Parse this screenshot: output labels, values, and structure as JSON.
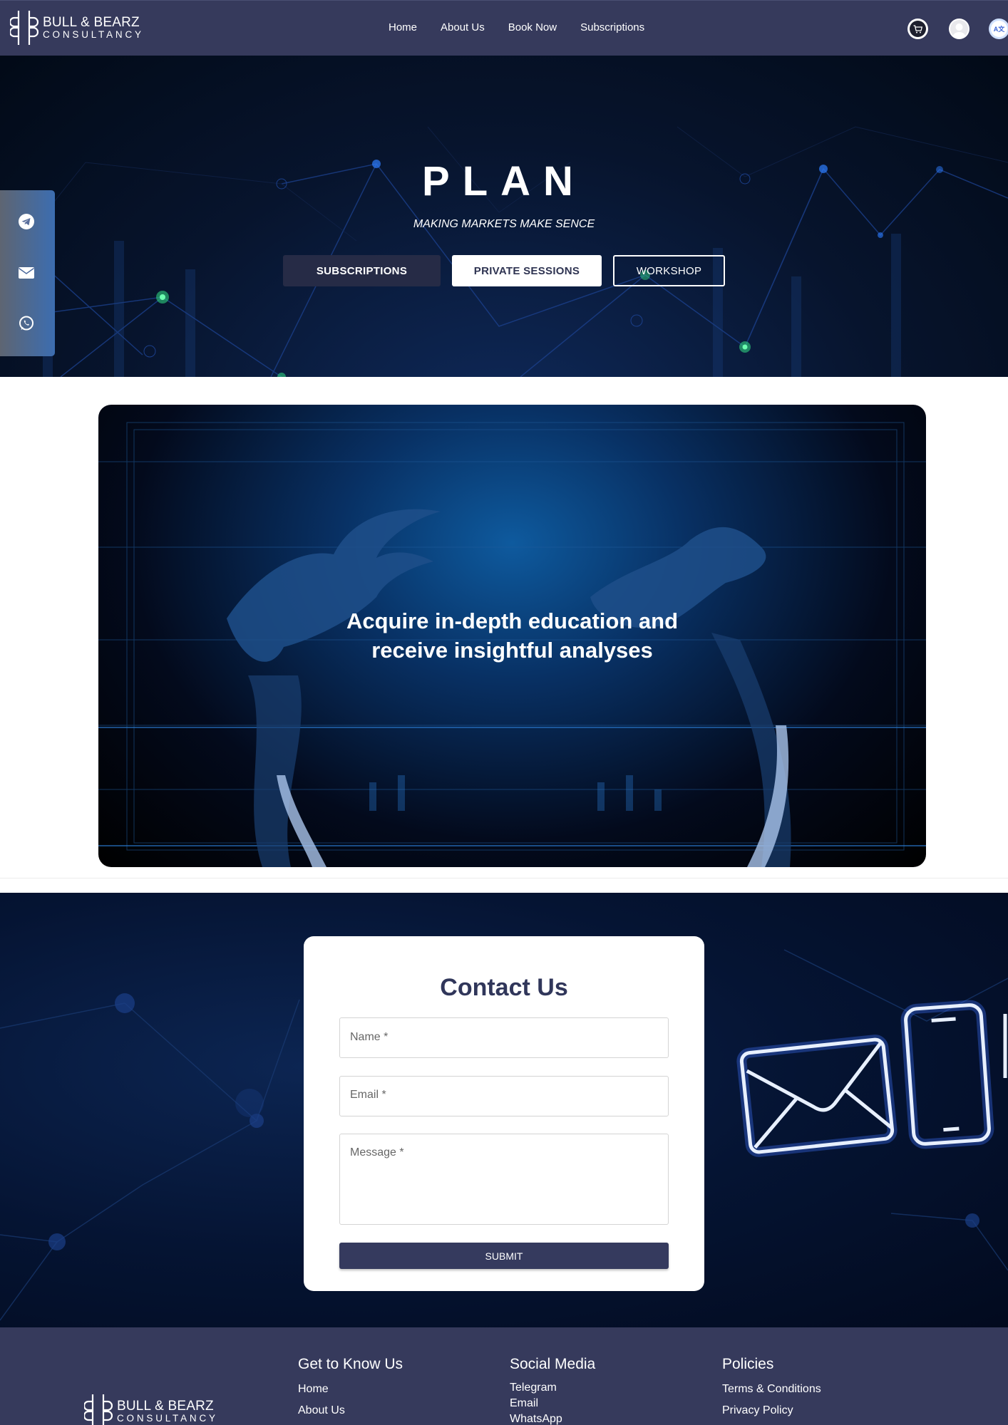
{
  "brand": {
    "line1": "BULL & BEARZ",
    "line2": "CONSULTANCY"
  },
  "nav": {
    "links": [
      "Home",
      "About Us",
      "Book Now",
      "Subscriptions"
    ],
    "icons": [
      "cart-icon",
      "user-icon",
      "translate-icon"
    ],
    "translate_glyph": "A文"
  },
  "hero": {
    "title": "PLAN",
    "tagline": "MAKING MARKETS MAKE SENCE",
    "buttons": {
      "subscriptions": "SUBSCRIPTIONS",
      "private_sessions": "PRIVATE SESSIONS",
      "workshop": "WORKSHOP"
    }
  },
  "social": {
    "items": [
      "telegram-icon",
      "email-icon",
      "whatsapp-icon"
    ]
  },
  "promo": {
    "line1": "Acquire in-depth education and",
    "line2": "receive insightful analyses"
  },
  "contact": {
    "title": "Contact Us",
    "name_label": "Name *",
    "email_label": "Email *",
    "message_label": "Message *",
    "submit": "SUBMIT"
  },
  "footer": {
    "col1": {
      "heading": "Get to Know Us",
      "links": [
        "Home",
        "About Us"
      ]
    },
    "col2": {
      "heading": "Social Media",
      "links": [
        "Telegram",
        "Email",
        "WhatsApp"
      ]
    },
    "col3": {
      "heading": "Policies",
      "links": [
        "Terms & Conditions",
        "Privacy Policy"
      ]
    }
  },
  "colors": {
    "navbar": "#363a5c",
    "accent_dark": "#353a5e",
    "hero_bg": "#07142d",
    "white": "#ffffff"
  }
}
